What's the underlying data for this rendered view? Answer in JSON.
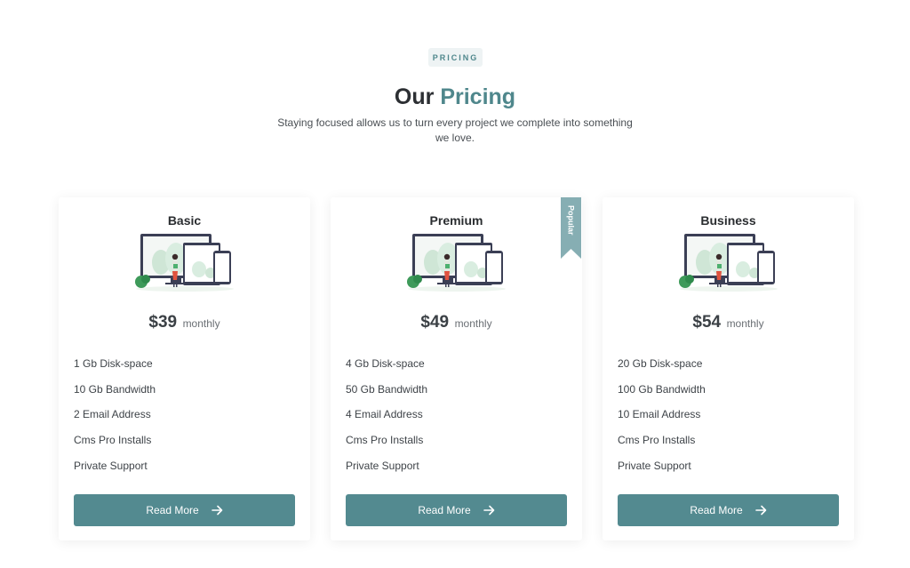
{
  "header": {
    "badge": "PRICING",
    "title_plain": "Our",
    "title_accent": "Pricing",
    "subtitle": "Staying focused allows us to turn every project we complete into something we love."
  },
  "colors": {
    "accent": "#4f878c",
    "button": "#538a90",
    "ribbon": "#86aeb3"
  },
  "plans": [
    {
      "name": "Basic",
      "price": "$39",
      "period": "monthly",
      "features": [
        "1 Gb Disk-space",
        "10 Gb Bandwidth",
        "2 Email Address",
        "Cms Pro Installs",
        "Private Support"
      ],
      "button_label": "Read More"
    },
    {
      "name": "Premium",
      "price": "$49",
      "period": "monthly",
      "ribbon": "Popular",
      "features": [
        "4 Gb Disk-space",
        "50 Gb Bandwidth",
        "4 Email Address",
        "Cms Pro Installs",
        "Private Support"
      ],
      "button_label": "Read More"
    },
    {
      "name": "Business",
      "price": "$54",
      "period": "monthly",
      "features": [
        "20 Gb Disk-space",
        "100 Gb Bandwidth",
        "10 Email Address",
        "Cms Pro Installs",
        "Private Support"
      ],
      "button_label": "Read More"
    }
  ]
}
